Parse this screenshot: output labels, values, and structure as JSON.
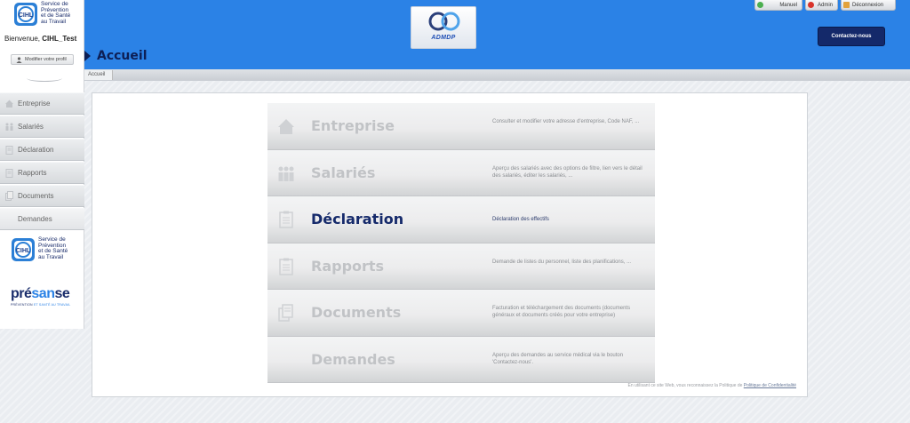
{
  "colors": {
    "banner": "#2b82e6",
    "navy": "#14296a",
    "active_title": "#152a6b",
    "inactive_title": "#c1c3c6"
  },
  "header": {
    "page_title": "Accueil",
    "center_logo_text": "ADMDP",
    "top_links": [
      {
        "label": "Manuel",
        "icon": "green-check-icon"
      },
      {
        "label": "Admin",
        "icon": "red-gear-icon"
      },
      {
        "label": "Déconnexion",
        "icon": "lock-icon"
      }
    ],
    "contact_button": "Contactez-nous"
  },
  "breadcrumb": [
    "Accueil"
  ],
  "sidebar": {
    "logo_text": [
      "Service de",
      "Prévention",
      "et de Santé",
      "au Travail"
    ],
    "welcome_prefix": "Bienvenue,",
    "user_name": "CIHL_Test",
    "profile_button": "Modifier votre profil",
    "items": [
      {
        "label": "Entreprise",
        "icon": "house-icon"
      },
      {
        "label": "Salariés",
        "icon": "people-icon"
      },
      {
        "label": "Déclaration",
        "icon": "clipboard-icon"
      },
      {
        "label": "Rapports",
        "icon": "clipboard-icon"
      },
      {
        "label": "Documents",
        "icon": "documents-icon"
      },
      {
        "label": "Demandes",
        "icon": ""
      }
    ],
    "presanse_word_a": "pré",
    "presanse_word_b": "san",
    "presanse_word_c": "se",
    "presanse_tag_a": "PRÉVENTION",
    "presanse_tag_b": "ET SANTÉ AU TRAVAIL"
  },
  "menu": [
    {
      "title": "Entreprise",
      "desc": "Consulter et modifier votre adresse d'entreprise, Code NAF, ...",
      "icon": "house-icon",
      "active": false
    },
    {
      "title": "Salariés",
      "desc": "Aperçu des salariés avec des options de filtre, lien vers le détail des salariés, éditer les salariés, ...",
      "icon": "people-icon",
      "active": false
    },
    {
      "title": "Déclaration",
      "desc": "Déclaration des effectifs",
      "icon": "clipboard-icon",
      "active": true
    },
    {
      "title": "Rapports",
      "desc": "Demande de listes du personnel, liste des planifications, ...",
      "icon": "clipboard-icon",
      "active": false
    },
    {
      "title": "Documents",
      "desc": "Facturation et téléchargement des documents (documents généraux et documents créés pour votre entreprise)",
      "icon": "documents-icon",
      "active": false
    },
    {
      "title": "Demandes",
      "desc": "Aperçu des demandes au service médical via le bouton 'Contactez-nous'.",
      "icon": "",
      "active": false
    }
  ],
  "footer": {
    "text": "En utilisant ce site Web, vous reconnaissez la Politique de",
    "link": "Politique de Confidentialité"
  }
}
